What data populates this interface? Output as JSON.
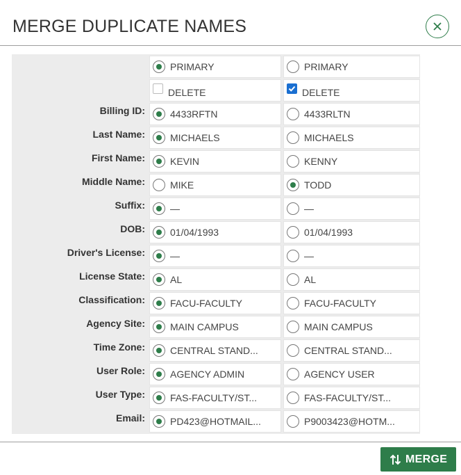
{
  "dialog": {
    "title": "MERGE DUPLICATE NAMES",
    "close_icon": "close-icon"
  },
  "primary_row": {
    "left_label": "PRIMARY",
    "left_selected": true,
    "right_label": "PRIMARY",
    "right_selected": false
  },
  "delete_row": {
    "left_label": "DELETE",
    "left_checked": false,
    "right_label": "DELETE",
    "right_checked": true
  },
  "fields": [
    {
      "label": "Billing ID:",
      "left": "4433RFTN",
      "right": "4433RLTN",
      "selected": "left"
    },
    {
      "label": "Last Name:",
      "left": "MICHAELS",
      "right": "MICHAELS",
      "selected": "left"
    },
    {
      "label": "First Name:",
      "left": "KEVIN",
      "right": "KENNY",
      "selected": "left"
    },
    {
      "label": "Middle Name:",
      "left": "MIKE",
      "right": "TODD",
      "selected": "right"
    },
    {
      "label": "Suffix:",
      "left": "—",
      "right": "—",
      "selected": "left"
    },
    {
      "label": "DOB:",
      "left": "01/04/1993",
      "right": "01/04/1993",
      "selected": "left"
    },
    {
      "label": "Driver's License:",
      "left": "—",
      "right": "—",
      "selected": "left"
    },
    {
      "label": "License State:",
      "left": "AL",
      "right": "AL",
      "selected": "left"
    },
    {
      "label": "Classification:",
      "left": "FACU-FACULTY",
      "right": "FACU-FACULTY",
      "selected": "left"
    },
    {
      "label": "Agency Site:",
      "left": "MAIN CAMPUS",
      "right": "MAIN CAMPUS",
      "selected": "left"
    },
    {
      "label": "Time Zone:",
      "left": "CENTRAL STAND...",
      "right": "CENTRAL STAND...",
      "selected": "left"
    },
    {
      "label": "User Role:",
      "left": "AGENCY ADMIN",
      "right": "AGENCY USER",
      "selected": "left"
    },
    {
      "label": "User Type:",
      "left": "FAS-FACULTY/ST...",
      "right": "FAS-FACULTY/ST...",
      "selected": "left"
    },
    {
      "label": "Email:",
      "left": "PD423@HOTMAIL...",
      "right": "P9003423@HOTM...",
      "selected": "left"
    }
  ],
  "footer": {
    "merge_label": "MERGE",
    "merge_icon": "sort-arrows-icon"
  },
  "colors": {
    "accent": "#2e7d4a",
    "checkbox": "#1a6fd1",
    "label_bg": "#ececec"
  }
}
